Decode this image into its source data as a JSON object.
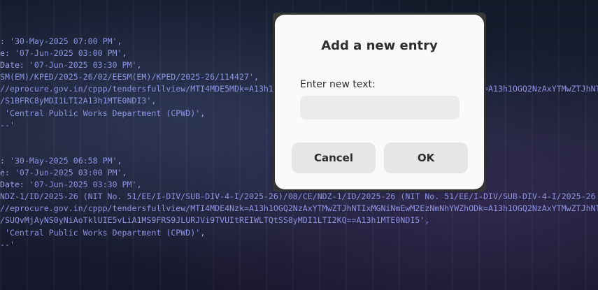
{
  "terminal": {
    "lines": [
      [
        {
          "t": ": ",
          "c": "k"
        },
        {
          "t": "'30-May-2025 07:00 PM'",
          "c": "s"
        },
        {
          "t": ",",
          "c": "k"
        }
      ],
      [
        {
          "t": "e: ",
          "c": "k"
        },
        {
          "t": "'07-Jun-2025 03:00 PM'",
          "c": "s"
        },
        {
          "t": ",",
          "c": "k"
        }
      ],
      [
        {
          "t": "Date: ",
          "c": "k"
        },
        {
          "t": "'07-Jun-2025 03:30 PM'",
          "c": "s"
        },
        {
          "t": ",",
          "c": "k"
        }
      ],
      [
        {
          "t": "SM(EM)/KPED/2025-26/02/EESM(EM)/KPED/2025-26/114427'",
          "c": "s"
        },
        {
          "t": ",",
          "c": "k"
        }
      ],
      [
        {
          "t": "//eprocure.gov.in/cppp/tendersfullview/MTI4MDE5MDk=A13h1OGQ2NzAxYTMwZTJhNTIxMGNiNmEwM2EzNmNhYWZhODk=A13h1OGQ2NzAxYTMwZTJhNTI",
          "c": "s"
        }
      ],
      [
        {
          "t": "/S1BFRC8yMDI1LTI2A13h1MTE0NDI3'",
          "c": "s"
        },
        {
          "t": ",",
          "c": "k"
        }
      ],
      [
        {
          "t": " 'Central Public Works Department (CPWD)'",
          "c": "s"
        },
        {
          "t": ",",
          "c": "k"
        }
      ],
      [
        {
          "t": "--'",
          "c": "s"
        }
      ],
      [
        {
          "t": "",
          "c": "k"
        }
      ],
      [
        {
          "t": "",
          "c": "k"
        }
      ],
      [
        {
          "t": ": ",
          "c": "k"
        },
        {
          "t": "'30-May-2025 06:58 PM'",
          "c": "s"
        },
        {
          "t": ",",
          "c": "k"
        }
      ],
      [
        {
          "t": "e: ",
          "c": "k"
        },
        {
          "t": "'07-Jun-2025 03:00 PM'",
          "c": "s"
        },
        {
          "t": ",",
          "c": "k"
        }
      ],
      [
        {
          "t": "Date: ",
          "c": "k"
        },
        {
          "t": "'07-Jun-2025 03:30 PM'",
          "c": "s"
        },
        {
          "t": ",",
          "c": "k"
        }
      ],
      [
        {
          "t": "NDZ-1/ID/2025-26 (NIT No. 51/EE/I-DIV/SUB-DIV-4-I/2025-26)/08/CE/NDZ-1/ID/2025-26 (NIT No. 51/EE/I-DIV/SUB-DIV-4-I/2025-26",
          "c": "s"
        }
      ],
      [
        {
          "t": "//eprocure.gov.in/cppp/tendersfullview/MTI4MDE4Nzk=A13h1OGQ2NzAxYTMwZTJhNTIxMGNiNmEwM2EzNmNhYWZhODk=A13h1OGQ2NzAxYTMwZTJhNT",
          "c": "s"
        }
      ],
      [
        {
          "t": "/SUQvMjAyNS0yNiAoTklUIE5vLiA1MS9FRS9JLURJVi9TVUItREIWLTQtSS8yMDI1LTI2KQ==A13h1MTE0NDI5'",
          "c": "s"
        },
        {
          "t": ",",
          "c": "k"
        }
      ],
      [
        {
          "t": " 'Central Public Works Department (CPWD)'",
          "c": "s"
        },
        {
          "t": ",",
          "c": "k"
        }
      ],
      [
        {
          "t": "--'",
          "c": "s"
        }
      ]
    ]
  },
  "dialog": {
    "title": "Add a new entry",
    "field_label": "Enter new text:",
    "input_value": "",
    "input_placeholder": "",
    "cancel_label": "Cancel",
    "ok_label": "OK"
  }
}
